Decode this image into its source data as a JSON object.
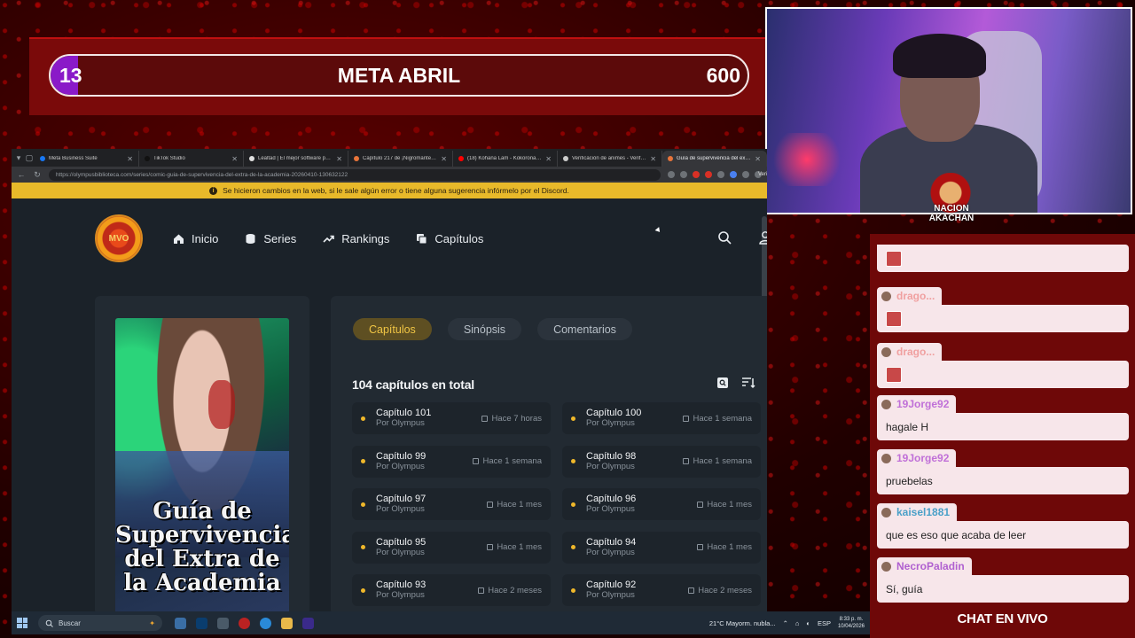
{
  "goal": {
    "current": "13",
    "title": "META ABRIL",
    "target": "600",
    "progress_fraction": 0.022
  },
  "cam_logo_text": "NACION AKACHAN",
  "browser": {
    "tabs": [
      {
        "label": "Meta Business Suite",
        "color": "#1877f2",
        "active": false
      },
      {
        "label": "TikTok Studio",
        "color": "#111111",
        "active": false
      },
      {
        "label": "Lealtad | El mejor software para ...",
        "color": "#e0e0e0",
        "active": false
      },
      {
        "label": "Capítulo 217 de ¡Nigromante, ...",
        "color": "#e8743a",
        "active": false
      },
      {
        "label": "(18) Kohana Lam - Kokoronashi |",
        "color": "#ff0000",
        "active": false
      },
      {
        "label": "Verificación de animes - Verifica...",
        "color": "#cccccc",
        "active": false
      },
      {
        "label": "Guía de supervivencia del extra ...",
        "color": "#e8743a",
        "active": true
      }
    ],
    "url": "https://olympusbiblioteca.com/series/comic-guia-de-supervivencia-del-extra-de-la-academia-20260410-130632122",
    "profile_label": "Verifi"
  },
  "notice": {
    "text": "Se hicieron cambios en la web, si le sale algún error o tiene alguna sugerencia infórmelo por el Discord."
  },
  "site": {
    "logo_text": "MVO",
    "nav": [
      {
        "label": "Inicio",
        "icon": "home-icon"
      },
      {
        "label": "Series",
        "icon": "database-icon"
      },
      {
        "label": "Rankings",
        "icon": "trending-icon"
      },
      {
        "label": "Capítulos",
        "icon": "copy-icon"
      }
    ],
    "cover_title": "Guía de Supervivencia del Extra de la Academia",
    "tabs": [
      "Capítulos",
      "Sinópsis",
      "Comentarios"
    ],
    "active_tab": "Capítulos",
    "count_label": "104 capítulos en total",
    "chapters": [
      {
        "title": "Capítulo 101",
        "by": "Por Olympus",
        "time": "Hace 7 horas"
      },
      {
        "title": "Capítulo 100",
        "by": "Por Olympus",
        "time": "Hace 1 semana"
      },
      {
        "title": "Capítulo 99",
        "by": "Por Olympus",
        "time": "Hace 1 semana"
      },
      {
        "title": "Capítulo 98",
        "by": "Por Olympus",
        "time": "Hace 1 semana"
      },
      {
        "title": "Capítulo 97",
        "by": "Por Olympus",
        "time": "Hace 1 mes"
      },
      {
        "title": "Capítulo 96",
        "by": "Por Olympus",
        "time": "Hace 1 mes"
      },
      {
        "title": "Capítulo 95",
        "by": "Por Olympus",
        "time": "Hace 1 mes"
      },
      {
        "title": "Capítulo 94",
        "by": "Por Olympus",
        "time": "Hace 1 mes"
      },
      {
        "title": "Capítulo 93",
        "by": "Por Olympus",
        "time": "Hace 2 meses"
      },
      {
        "title": "Capítulo 92",
        "by": "Por Olympus",
        "time": "Hace 2 meses"
      }
    ]
  },
  "taskbar": {
    "search_placeholder": "Buscar",
    "weather": "21°C  Mayorm. nubla...",
    "lang": "ESP",
    "time": "8:33 p. m.",
    "date": "10/04/2026"
  },
  "chat": {
    "messages": [
      {
        "user": "",
        "text": "",
        "emote": true,
        "user_color": "#e98aa0"
      },
      {
        "user": "drago...",
        "text": "",
        "emote": true,
        "user_color": "#f0a0a0"
      },
      {
        "user": "drago...",
        "text": "",
        "emote": true,
        "user_color": "#f0a0a0"
      },
      {
        "user": "19Jorge92",
        "text": "hagale H",
        "emote": false,
        "user_color": "#c070d8"
      },
      {
        "user": "19Jorge92",
        "text": "pruebelas",
        "emote": false,
        "user_color": "#c070d8"
      },
      {
        "user": "kaisel1881",
        "text": "que es eso que acaba de leer",
        "emote": false,
        "user_color": "#4aa0c8"
      },
      {
        "user": "NecroPaladin",
        "text": "Sí, guía",
        "emote": false,
        "user_color": "#b060d0"
      }
    ],
    "footer": "CHAT EN VIVO"
  }
}
